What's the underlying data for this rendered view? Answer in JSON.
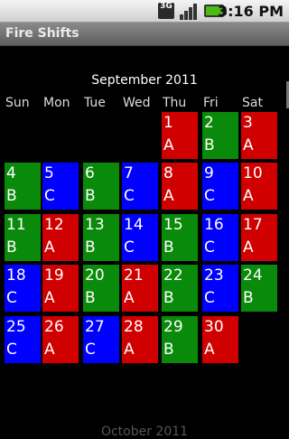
{
  "status": {
    "network_label": "3G",
    "time": "3:16 PM"
  },
  "app": {
    "title": "Fire Shifts"
  },
  "calendar": {
    "month_title": "September 2011",
    "weekdays": [
      "Sun",
      "Mon",
      "Tue",
      "Wed",
      "Thu",
      "Fri",
      "Sat"
    ],
    "shift_colors": {
      "A": "#d10000",
      "B": "#0a8a0a",
      "C": "#0000ff"
    },
    "first_weekday_index": 4,
    "days": [
      {
        "day": "1",
        "shift": "A"
      },
      {
        "day": "2",
        "shift": "B"
      },
      {
        "day": "3",
        "shift": "A"
      },
      {
        "day": "4",
        "shift": "B"
      },
      {
        "day": "5",
        "shift": "C"
      },
      {
        "day": "6",
        "shift": "B"
      },
      {
        "day": "7",
        "shift": "C"
      },
      {
        "day": "8",
        "shift": "A"
      },
      {
        "day": "9",
        "shift": "C"
      },
      {
        "day": "10",
        "shift": "A"
      },
      {
        "day": "11",
        "shift": "B"
      },
      {
        "day": "12",
        "shift": "A"
      },
      {
        "day": "13",
        "shift": "B"
      },
      {
        "day": "14",
        "shift": "C"
      },
      {
        "day": "15",
        "shift": "B"
      },
      {
        "day": "16",
        "shift": "C"
      },
      {
        "day": "17",
        "shift": "A"
      },
      {
        "day": "18",
        "shift": "C"
      },
      {
        "day": "19",
        "shift": "A"
      },
      {
        "day": "20",
        "shift": "B"
      },
      {
        "day": "21",
        "shift": "A"
      },
      {
        "day": "22",
        "shift": "B"
      },
      {
        "day": "23",
        "shift": "C"
      },
      {
        "day": "24",
        "shift": "B"
      },
      {
        "day": "25",
        "shift": "C"
      },
      {
        "day": "26",
        "shift": "A"
      },
      {
        "day": "27",
        "shift": "C"
      },
      {
        "day": "28",
        "shift": "A"
      },
      {
        "day": "29",
        "shift": "B"
      },
      {
        "day": "30",
        "shift": "A"
      }
    ],
    "next_month_title": "October 2011"
  }
}
